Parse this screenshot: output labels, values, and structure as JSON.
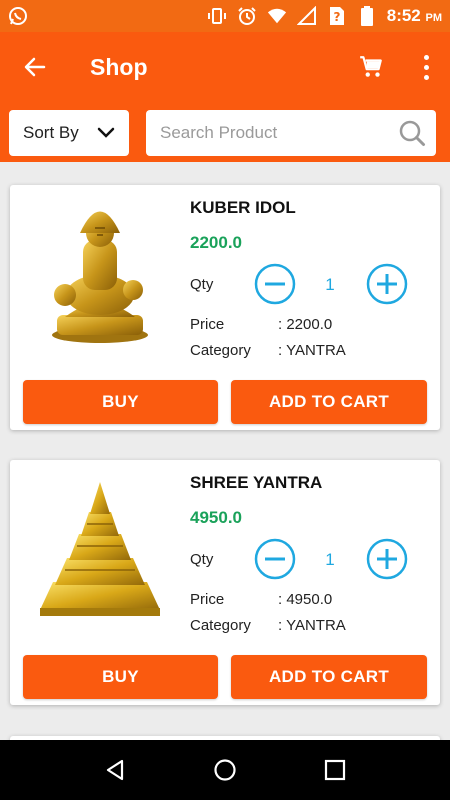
{
  "status_bar": {
    "time": "8:52",
    "ampm": "PM",
    "icons": [
      "whatsapp-icon",
      "vibrate-icon",
      "alarm-icon",
      "wifi-icon",
      "signal-icon",
      "sim-unknown-icon",
      "battery-icon"
    ]
  },
  "toolbar": {
    "title": "Shop",
    "back_icon": "arrow-left-icon",
    "cart_icon": "cart-icon",
    "more_icon": "more-vertical-icon"
  },
  "filter": {
    "sort_label": "Sort By",
    "search_placeholder": "Search Product"
  },
  "colors": {
    "primary": "#fa5a0f",
    "statusbar": "#f26a13",
    "price_green": "#1aa25a",
    "qty_blue": "#1fa8e0"
  },
  "products": [
    {
      "name": "KUBER IDOL",
      "price_display": "2200.0",
      "qty_label": "Qty",
      "qty": "1",
      "price_label": "Price",
      "price_value": ": 2200.0",
      "category_label": "Category",
      "category_value": ": YANTRA",
      "buy_label": "BUY",
      "add_label": "ADD TO CART"
    },
    {
      "name": "SHREE YANTRA",
      "price_display": "4950.0",
      "qty_label": "Qty",
      "qty": "1",
      "price_label": "Price",
      "price_value": ": 4950.0",
      "category_label": "Category",
      "category_value": ": YANTRA",
      "buy_label": "BUY",
      "add_label": "ADD TO CART"
    }
  ]
}
